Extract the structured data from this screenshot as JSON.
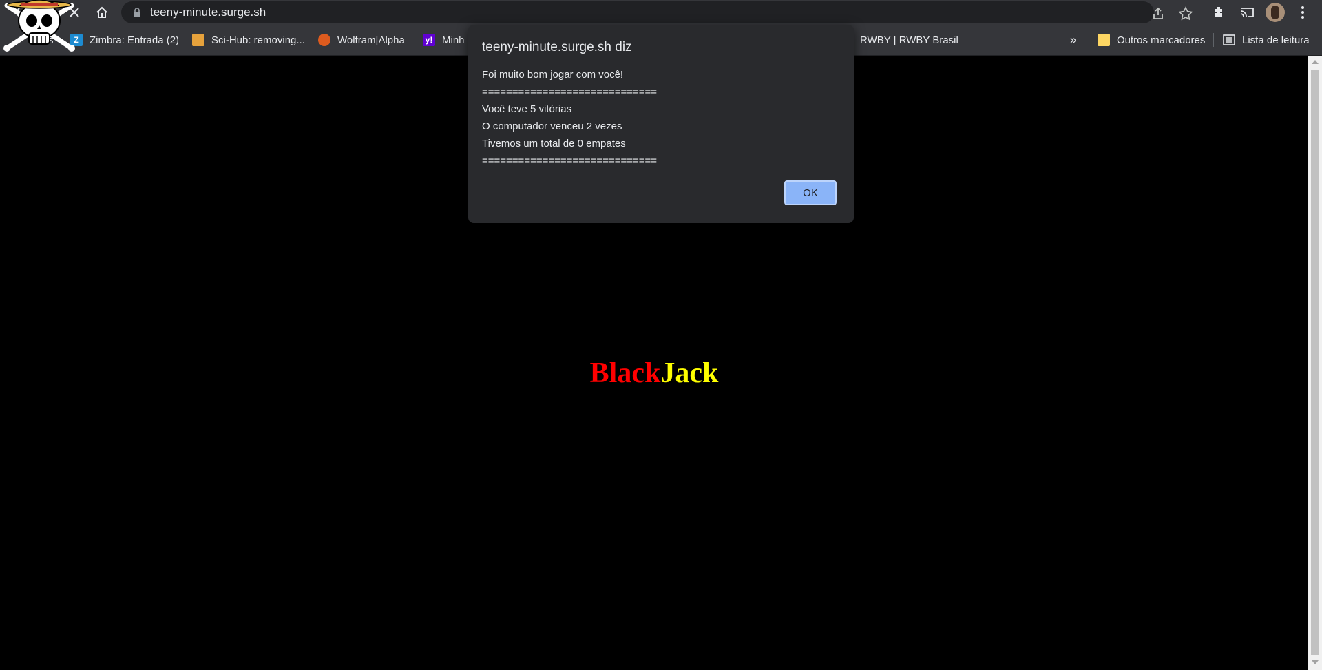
{
  "browser": {
    "url": "teeny-minute.surge.sh"
  },
  "bookmarks": {
    "items": [
      {
        "label": "s"
      },
      {
        "label": "Zimbra: Entrada (2)",
        "icon": "zimbra-icon"
      },
      {
        "label": "Sci-Hub: removing...",
        "icon": "scihub-icon"
      },
      {
        "label": "Wolfram|Alpha",
        "icon": "wolfram-icon"
      },
      {
        "label": "Minh",
        "icon": "yahoo-icon"
      },
      {
        "label": "RWBY | RWBY Brasil"
      }
    ],
    "overflow": "»",
    "other_folder": "Outros marcadores",
    "reading_list": "Lista de leitura"
  },
  "page": {
    "title_part1": "Black",
    "title_part2": "Jack",
    "colors": {
      "black_part": "#ff0000",
      "jack_part": "#ffff00",
      "background": "#000000"
    }
  },
  "dialog": {
    "title": "teeny-minute.surge.sh diz",
    "lines": [
      "Foi muito bom jogar com você!",
      "=============================",
      "Você teve 5 vitórias",
      "O computador venceu 2 vezes",
      "Tivemos um total de 0 empates",
      "============================="
    ],
    "ok_label": "OK"
  }
}
